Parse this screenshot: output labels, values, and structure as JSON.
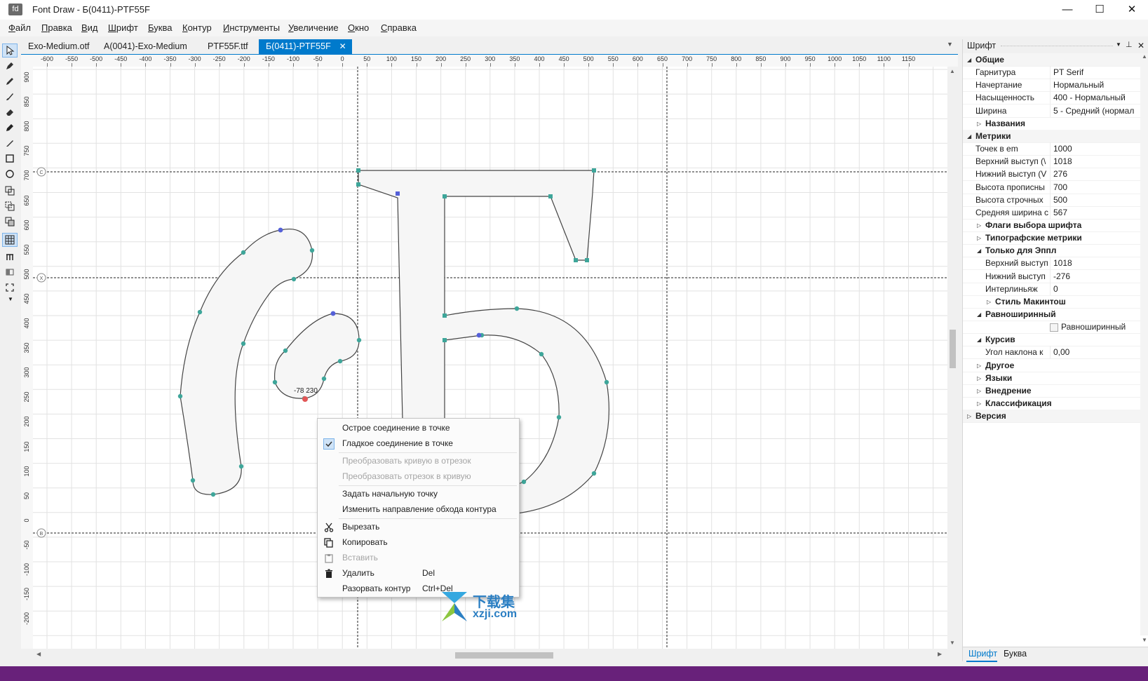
{
  "app": {
    "icon_text": "fd",
    "title": "Font Draw - Б(0411)-PTF55F"
  },
  "window_controls": {
    "minimize": "—",
    "maximize": "☐",
    "close": "✕"
  },
  "menu": [
    {
      "label": "Файл"
    },
    {
      "label": "Правка"
    },
    {
      "label": "Вид"
    },
    {
      "label": "Шрифт"
    },
    {
      "label": "Буква"
    },
    {
      "label": "Контур"
    },
    {
      "label": "Инструменты"
    },
    {
      "label": "Увеличение"
    },
    {
      "label": "Окно"
    },
    {
      "label": "Справка"
    }
  ],
  "tabs": [
    {
      "label": "Exo-Medium.otf",
      "active": false
    },
    {
      "label": "A(0041)-Exo-Medium",
      "active": false
    },
    {
      "label": "PTF55F.ttf",
      "active": false
    },
    {
      "label": "Б(0411)-PTF55F",
      "active": true
    }
  ],
  "tools": [
    {
      "icon": "pointer-icon"
    },
    {
      "icon": "pen-icon"
    },
    {
      "icon": "pencil-icon"
    },
    {
      "icon": "brush-icon"
    },
    {
      "icon": "eraser-icon"
    },
    {
      "icon": "marker-icon"
    },
    {
      "icon": "knife-icon"
    },
    {
      "icon": "rectangle-icon"
    },
    {
      "icon": "ellipse-icon"
    },
    {
      "icon": "union-icon"
    },
    {
      "icon": "subtract-icon"
    },
    {
      "icon": "intersect-icon"
    },
    {
      "icon": "grid-icon"
    },
    {
      "icon": "metrics-icon"
    },
    {
      "icon": "preview-icon"
    },
    {
      "icon": "fit-icon"
    }
  ],
  "ruler": {
    "h_ticks": [
      "-600",
      "-550",
      "-500",
      "-450",
      "-400",
      "-350",
      "-300",
      "-250",
      "-200",
      "-150",
      "-100",
      "-50",
      "0",
      "50",
      "100",
      "150",
      "200",
      "250",
      "300",
      "350",
      "400",
      "450",
      "500",
      "550",
      "600",
      "650",
      "700",
      "750",
      "800",
      "850",
      "900",
      "950",
      "1000",
      "1050",
      "1100",
      "1150"
    ],
    "v_ticks": [
      "900",
      "850",
      "800",
      "750",
      "700",
      "650",
      "600",
      "550",
      "500",
      "450",
      "400",
      "350",
      "300",
      "250",
      "200",
      "150",
      "100",
      "50",
      "0",
      "-50",
      "-100",
      "-150",
      "-200"
    ]
  },
  "guides": {
    "c": "C",
    "x": "X",
    "b": "B"
  },
  "point_readout": "-78 230",
  "context_menu": {
    "items": [
      {
        "label": "Острое соединение в точке",
        "shortcut": "",
        "icon": "",
        "disabled": false,
        "checked": false
      },
      {
        "label": "Гладкое соединение в точке",
        "shortcut": "",
        "icon": "check-icon",
        "disabled": false,
        "checked": true
      },
      {
        "label": "Преобразовать кривую в отрезок",
        "shortcut": "",
        "icon": "",
        "disabled": true,
        "checked": false
      },
      {
        "label": "Преобразовать отрезок в кривую",
        "shortcut": "",
        "icon": "",
        "disabled": true,
        "checked": false
      },
      {
        "label": "Задать начальную точку",
        "shortcut": "",
        "icon": "",
        "disabled": false,
        "checked": false
      },
      {
        "label": "Изменить направление обхода контура",
        "shortcut": "",
        "icon": "",
        "disabled": false,
        "checked": false
      },
      {
        "label": "Вырезать",
        "shortcut": "",
        "icon": "scissors-icon",
        "disabled": false,
        "checked": false
      },
      {
        "label": "Копировать",
        "shortcut": "",
        "icon": "copy-icon",
        "disabled": false,
        "checked": false
      },
      {
        "label": "Вставить",
        "shortcut": "",
        "icon": "paste-icon",
        "disabled": true,
        "checked": false
      },
      {
        "label": "Удалить",
        "shortcut": "Del",
        "icon": "trash-icon",
        "disabled": false,
        "checked": false
      },
      {
        "label": "Разорвать контур",
        "shortcut": "Ctrl+Del",
        "icon": "",
        "disabled": false,
        "checked": false
      }
    ]
  },
  "panel": {
    "title": "Шрифт",
    "pin": "📌",
    "close": "✕",
    "rows": [
      {
        "label": "Общие",
        "value": "",
        "kind": "cat",
        "indent": 0,
        "expand": "open"
      },
      {
        "label": "Гарнитура",
        "value": "PT Serif",
        "kind": "prop",
        "indent": 1
      },
      {
        "label": "Начертание",
        "value": "Нормальный",
        "kind": "prop",
        "indent": 1
      },
      {
        "label": "Насыщенность",
        "value": "400 - Нормальный",
        "kind": "prop",
        "indent": 1
      },
      {
        "label": "Ширина",
        "value": "5 - Средний (нормал",
        "kind": "prop",
        "indent": 1
      },
      {
        "label": "Названия",
        "value": "",
        "kind": "sub",
        "indent": 1,
        "expand": "closed"
      },
      {
        "label": "Метрики",
        "value": "",
        "kind": "cat",
        "indent": 0,
        "expand": "open"
      },
      {
        "label": "Точек в em",
        "value": "1000",
        "kind": "prop",
        "indent": 1
      },
      {
        "label": "Верхний выступ (\\",
        "value": "1018",
        "kind": "prop",
        "indent": 1
      },
      {
        "label": "Нижний выступ (V",
        "value": "276",
        "kind": "prop",
        "indent": 1
      },
      {
        "label": "Высота прописны",
        "value": "700",
        "kind": "prop",
        "indent": 1
      },
      {
        "label": "Высота строчных",
        "value": "500",
        "kind": "prop",
        "indent": 1
      },
      {
        "label": "Средняя ширина с",
        "value": "567",
        "kind": "prop",
        "indent": 1
      },
      {
        "label": "Флаги выбора шрифта",
        "value": "",
        "kind": "sub",
        "indent": 1,
        "expand": "closed"
      },
      {
        "label": "Типографские метрики",
        "value": "",
        "kind": "sub",
        "indent": 1,
        "expand": "closed"
      },
      {
        "label": "Только для Эппл",
        "value": "",
        "kind": "sub",
        "indent": 1,
        "expand": "open"
      },
      {
        "label": "Верхний выступ",
        "value": "1018",
        "kind": "prop",
        "indent": 2
      },
      {
        "label": "Нижний выступ",
        "value": "-276",
        "kind": "prop",
        "indent": 2
      },
      {
        "label": "Интерлиньяж",
        "value": "0",
        "kind": "prop",
        "indent": 2
      },
      {
        "label": "Стиль Макинтош",
        "value": "",
        "kind": "sub",
        "indent": 2,
        "expand": "closed"
      },
      {
        "label": "Равноширинный",
        "value": "",
        "kind": "sub",
        "indent": 1,
        "expand": "open"
      },
      {
        "label": "",
        "value": "Равноширинный",
        "kind": "check",
        "indent": 2
      },
      {
        "label": "Курсив",
        "value": "",
        "kind": "sub",
        "indent": 1,
        "expand": "open"
      },
      {
        "label": "Угол наклона к",
        "value": "0,00",
        "kind": "prop",
        "indent": 2
      },
      {
        "label": "Другое",
        "value": "",
        "kind": "sub",
        "indent": 1,
        "expand": "closed"
      },
      {
        "label": "Языки",
        "value": "",
        "kind": "sub",
        "indent": 1,
        "expand": "closed"
      },
      {
        "label": "Внедрение",
        "value": "",
        "kind": "sub",
        "indent": 1,
        "expand": "closed"
      },
      {
        "label": "Классификация",
        "value": "",
        "kind": "sub",
        "indent": 1,
        "expand": "closed"
      },
      {
        "label": "Версия",
        "value": "",
        "kind": "cat",
        "indent": 0,
        "expand": "closed"
      }
    ],
    "tabs": [
      {
        "label": "Шрифт",
        "active": true
      },
      {
        "label": "Буква",
        "active": false
      }
    ]
  },
  "watermark": {
    "line1": "下载集",
    "line2": "xzji.com"
  },
  "colors": {
    "accent": "#007acc",
    "status": "#68217a",
    "node": "#3ea69a",
    "selected_node": "#5560d8",
    "red_node": "#e25757"
  }
}
